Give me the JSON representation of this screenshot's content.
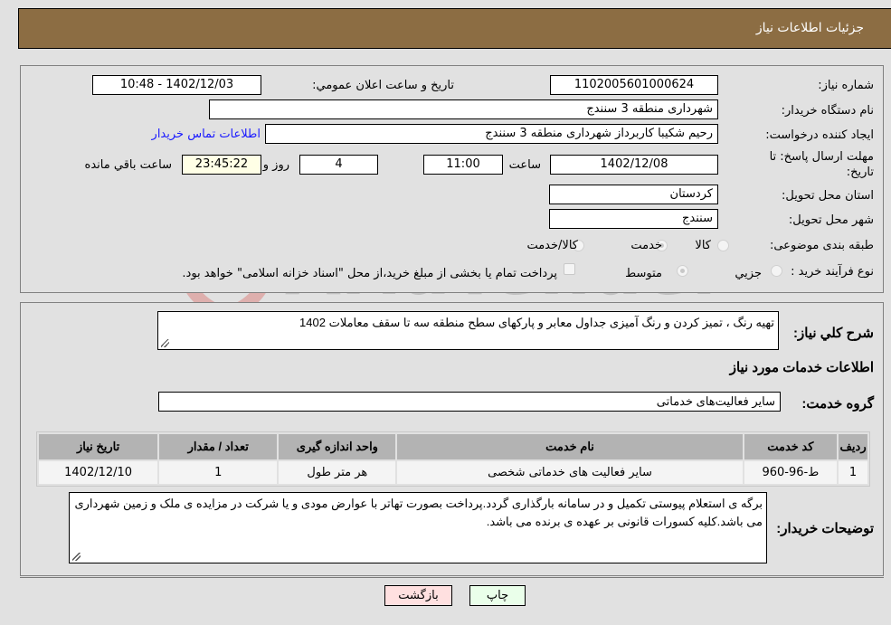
{
  "header": {
    "title": "جزئیات اطلاعات نیاز"
  },
  "details": {
    "need_number_label": "شماره نیاز:",
    "need_number": "1102005601000624",
    "announce_label": "تاریخ و ساعت اعلان عمومي:",
    "announce_value": "1402/12/03 - 10:48",
    "buyer_org_label": "نام دستگاه خریدار:",
    "buyer_org": "شهرداری منطقه 3 سنندج",
    "creator_label": "ایجاد کننده درخواست:",
    "creator": "رحیم شکیبا کاربرداز شهرداری منطقه 3 سنندج",
    "contact_link": "اطلاعات تماس خریدار",
    "deadline_label": "مهلت ارسال پاسخ: تا تاریخ:",
    "deadline_date": "1402/12/08",
    "time_label": "ساعت",
    "deadline_time": "11:00",
    "days_value": "4",
    "days_label": "روز و",
    "remaining_time": "23:45:22",
    "remaining_label": "ساعت باقي مانده",
    "province_label": "استان محل تحویل:",
    "province": "کردستان",
    "city_label": "شهر محل تحویل:",
    "city": "سنندج",
    "category_label": "طبقه بندی موضوعی:",
    "category_options": [
      {
        "label": "کالا",
        "checked": false
      },
      {
        "label": "خدمت",
        "checked": true
      },
      {
        "label": "کالا/خدمت",
        "checked": false
      }
    ],
    "process_label": "نوع فرآیند خرید :",
    "process_options": [
      {
        "label": "جزيي",
        "checked": false
      },
      {
        "label": "متوسط",
        "checked": true
      }
    ],
    "treasury_note": "پرداخت تمام یا بخشی از مبلغ خرید،از محل \"اسناد خزانه اسلامی\" خواهد بود."
  },
  "description": {
    "label": "شرح کلي نیاز:",
    "value": "تهیه رنگ ، تمیز کردن و رنگ آمیزی جداول معابر و پارکهای سطح منطقه سه تا سقف معاملات 1402"
  },
  "services": {
    "section_title": "اطلاعات خدمات مورد نیاز",
    "group_label": "گروه خدمت:",
    "group_value": "سایر فعالیت‌های خدماتی",
    "columns": [
      "ردیف",
      "کد خدمت",
      "نام خدمت",
      "واحد اندازه گیری",
      "تعداد / مقدار",
      "تاریخ نیاز"
    ],
    "rows": [
      [
        "1",
        "ط-96-960",
        "سایر فعالیت های خدماتی شخصی",
        "هر متر طول",
        "1",
        "1402/12/10"
      ]
    ]
  },
  "buyer_notes": {
    "label": "توضیحات خریدار:",
    "value": "برگه ی استعلام پیوستی تکمیل و در سامانه بارگذاری گردد.پرداخت بصورت تهاتر با عوارض مودی و یا شرکت در مزایده ی ملک و زمین شهرداری می باشد.کلیه کسورات قانونی بر عهده ی برنده می باشد."
  },
  "buttons": {
    "print": "چاپ",
    "back": "بازگشت"
  },
  "watermark": {
    "text": "AriaTender.neT"
  }
}
